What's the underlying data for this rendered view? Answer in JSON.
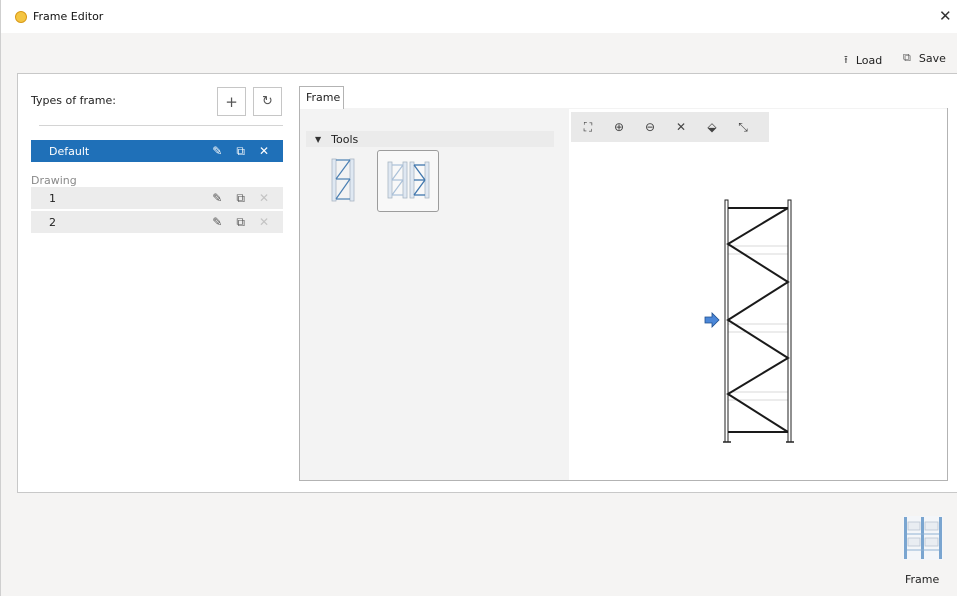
{
  "window": {
    "title": "Frame Editor",
    "close_glyph": "✕"
  },
  "toolbar": {
    "load_label": "Load",
    "load_icon": "⭱",
    "save_label": "Save",
    "save_icon": "⧉"
  },
  "left_panel": {
    "types_label": "Types of frame:",
    "add_glyph": "+",
    "refresh_glyph": "↻",
    "selected_item": {
      "label": "Default",
      "edit": "✎",
      "copy": "⧉",
      "delete": "✕"
    },
    "group_label": "Drawing",
    "items": [
      {
        "label": "1",
        "edit": "✎",
        "copy": "⧉",
        "delete": "✕"
      },
      {
        "label": "2",
        "edit": "✎",
        "copy": "⧉",
        "delete": "✕"
      }
    ]
  },
  "tab": {
    "label": "Frame"
  },
  "tools": {
    "header": "Tools",
    "arrow": "▼"
  },
  "canvas_toolbar": {
    "fit": "⛶",
    "zoom_in": "⊕",
    "zoom_out": "⊖",
    "clear": "✕",
    "eraser": "⬙",
    "measure": "⤡"
  },
  "bottom": {
    "thumbnail_label": "Frame"
  },
  "colors": {
    "accent": "#1f70b8",
    "frame_line": "#1a1a1a",
    "arrow_fill": "#4b87d8"
  }
}
